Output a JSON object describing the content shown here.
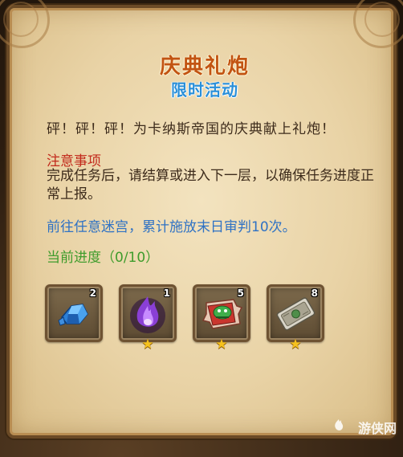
{
  "dialog": {
    "title": "庆典礼炮",
    "subtitle": "限时活动",
    "description": "砰！砰！砰！为卡纳斯帝国的庆典献上礼炮！",
    "note_title": "注意事项",
    "note_body": "完成任务后，请结算或进入下一层，以确保任务进度正常上报。",
    "goal": "前往任意迷宫，累计施放末日审判10次。",
    "progress": "当前进度（0/10）"
  },
  "rewards": [
    {
      "icon": "blue-crystal-icon",
      "count": "2",
      "starred": false
    },
    {
      "icon": "purple-flame-icon",
      "count": "1",
      "starred": true
    },
    {
      "icon": "dragon-puzzle-box-icon",
      "count": "5",
      "starred": true
    },
    {
      "icon": "ticket-card-icon",
      "count": "8",
      "starred": true
    }
  ],
  "watermark": {
    "text": "游侠网"
  },
  "colors": {
    "title": "#c25412",
    "subtitle": "#2a8fd8",
    "note_title": "#c22a1c",
    "goal": "#2f72c4",
    "progress": "#3f9c2c",
    "star": "#f6c21e"
  }
}
